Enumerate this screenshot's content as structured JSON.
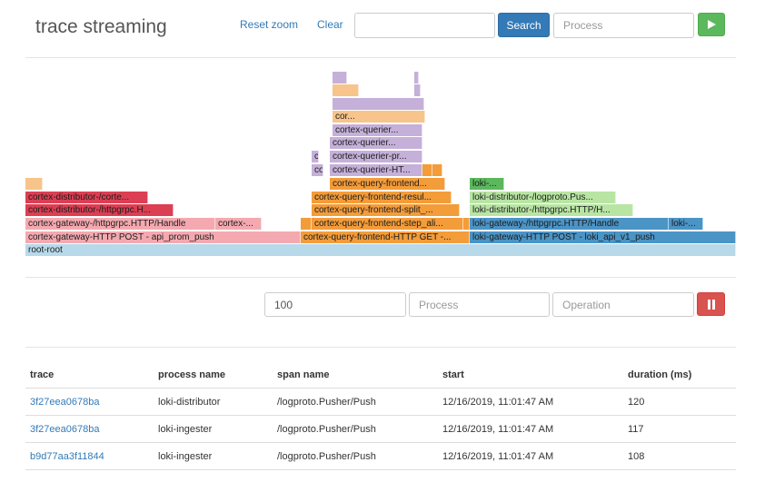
{
  "header": {
    "title": "trace streaming",
    "reset_zoom": "Reset zoom",
    "clear": "Clear",
    "search_value": "",
    "search_button": "Search",
    "process_placeholder": "Process",
    "play_icon": "play-icon"
  },
  "flame": {
    "blocks": [
      {
        "label": "root-root",
        "color": "#b8d9ea"
      },
      {
        "label": "cortex-gateway-HTTP POST - api_prom_push",
        "color": "#f4a9b0"
      },
      {
        "label": "cortex-query-frontend-HTTP GET -...",
        "color": "#f39c3a"
      },
      {
        "label": "loki-gateway-HTTP POST - loki_api_v1_push",
        "color": "#4b94c6"
      },
      {
        "label": "cortex-gateway-/httpgrpc.HTTP/Handle",
        "color": "#f4a9b0"
      },
      {
        "label": "cortex-...",
        "color": "#f4a9b0"
      },
      {
        "label": "",
        "color": "#f39c3a"
      },
      {
        "label": "cortex-query-frontend-step_ali...",
        "color": "#f39c3a"
      },
      {
        "label": "",
        "color": "#f39c3a"
      },
      {
        "label": "loki-gateway-/httpgrpc.HTTP/Handle",
        "color": "#4b94c6"
      },
      {
        "label": "loki-...",
        "color": "#4b94c6"
      },
      {
        "label": "cortex-distributor-/httpgrpc.H...",
        "color": "#dc3f53"
      },
      {
        "label": "cortex-query-frontend-split_...",
        "color": "#f39c3a"
      },
      {
        "label": "loki-distributor-/httpgrpc.HTTP/H...",
        "color": "#b8e5a3"
      },
      {
        "label": "cortex-distributor-/corte...",
        "color": "#dc3f53"
      },
      {
        "label": "cortex-query-frontend-resul...",
        "color": "#f39c3a"
      },
      {
        "label": "loki-distributor-/logproto.Pus...",
        "color": "#b8e5a3"
      },
      {
        "label": "",
        "color": "#f7c48b"
      },
      {
        "label": "cortex-query-frontend...",
        "color": "#f39c3a"
      },
      {
        "label": "loki-...",
        "color": "#5cb85c"
      },
      {
        "label": "cortex-querier-HT...",
        "color": "#c5b0d9"
      },
      {
        "label": "",
        "color": "#f39c3a"
      },
      {
        "label": "",
        "color": "#f39c3a"
      },
      {
        "label": "cortex-querier-pr...",
        "color": "#c5b0d9"
      },
      {
        "label": "cortex-querier-pr...",
        "color": "#c5b0d9"
      },
      {
        "label": "cortex-querier-pr...",
        "color": "#c5b0d9"
      },
      {
        "label": "cortex-querier...",
        "color": "#c5b0d9"
      },
      {
        "label": "cortex-querier...",
        "color": "#c5b0d9"
      },
      {
        "label": "cor...",
        "color": "#f7c48b"
      },
      {
        "label": "",
        "color": "#c5b0d9"
      },
      {
        "label": "",
        "color": "#f7c48b"
      },
      {
        "label": "",
        "color": "#c5b0d9"
      },
      {
        "label": "",
        "color": "#c5b0d9"
      },
      {
        "label": "",
        "color": "#c5b0d9"
      },
      {
        "label": "",
        "color": "#f39c3a"
      }
    ]
  },
  "controls": {
    "limit_value": "100",
    "process_placeholder": "Process",
    "operation_placeholder": "Operation",
    "pause_icon": "pause-icon"
  },
  "table": {
    "headers": [
      "trace",
      "process name",
      "span name",
      "start",
      "duration (ms)"
    ],
    "rows": [
      [
        "3f27eea0678ba",
        "loki-distributor",
        "/logproto.Pusher/Push",
        "12/16/2019, 11:01:47 AM",
        "120"
      ],
      [
        "3f27eea0678ba",
        "loki-ingester",
        "/logproto.Pusher/Push",
        "12/16/2019, 11:01:47 AM",
        "117"
      ],
      [
        "b9d77aa3f11844",
        "loki-ingester",
        "/logproto.Pusher/Push",
        "12/16/2019, 11:01:47 AM",
        "108"
      ]
    ]
  },
  "colors": {
    "link": "#337ab7",
    "search_button": "#337ab7",
    "play_button": "#5cb85c",
    "pause_button": "#d9534f"
  }
}
